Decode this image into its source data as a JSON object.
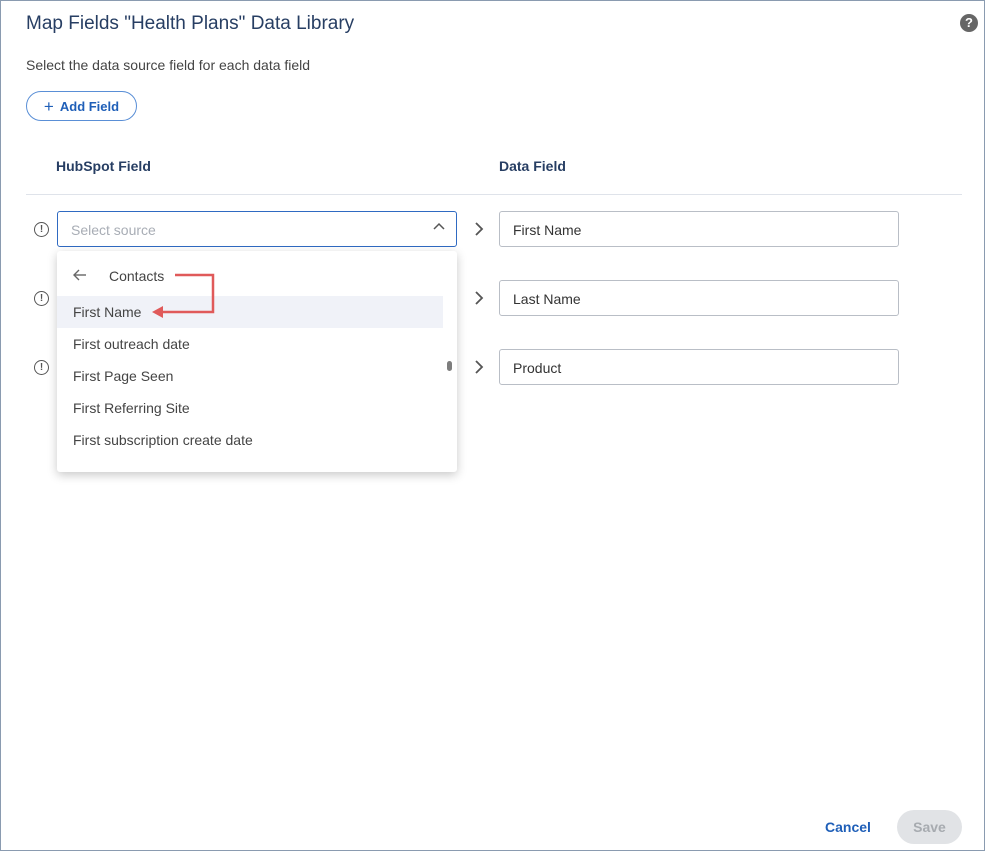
{
  "dialog": {
    "title": "Map Fields \"Health Plans\" Data Library",
    "subtitle": "Select the data source field for each data field",
    "help_icon": "question-circle-icon",
    "add_field_label": "Add Field"
  },
  "columns": {
    "source": "HubSpot Field",
    "target": "Data Field"
  },
  "source_select": {
    "placeholder": "Select source"
  },
  "dropdown": {
    "header": "Contacts",
    "options": [
      "First Name",
      "First outreach date",
      "First Page Seen",
      "First Referring Site",
      "First subscription create date"
    ],
    "highlighted": "First Name"
  },
  "data_fields": [
    "First Name",
    "Last Name",
    "Product"
  ],
  "footer": {
    "cancel_label": "Cancel",
    "save_label": "Save"
  },
  "colors": {
    "accent": "#1f5fb8",
    "title": "#273e63",
    "annotation": "#e05a5a"
  }
}
